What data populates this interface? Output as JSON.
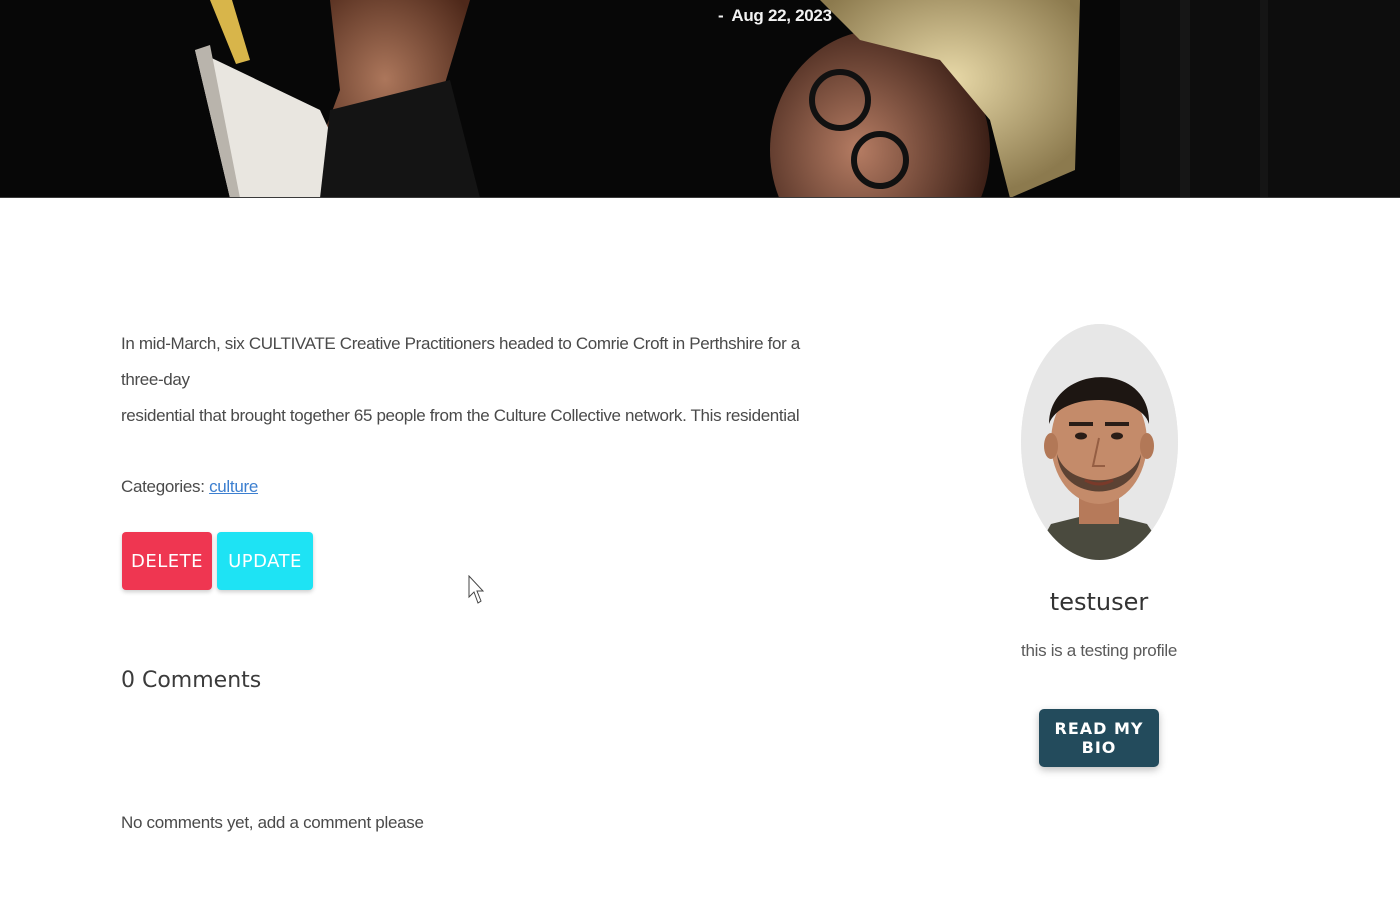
{
  "hero": {
    "date": "Aug 22, 2023",
    "separator": "-"
  },
  "post": {
    "excerpt_line1": "In mid-March, six CULTIVATE Creative Practitioners headed to Comrie Croft in Perthshire for a three-day",
    "excerpt_line2": "residential that brought together 65 people from the Culture Collective network. This residential",
    "categories_label": "Categories:",
    "category": "culture",
    "delete_label": "DELETE",
    "update_label": "UPDATE"
  },
  "comments": {
    "title": "0 Comments",
    "empty_message": "No comments yet, add a comment please"
  },
  "author": {
    "name": "testuser",
    "tagline": "this is a testing profile",
    "bio_button_label": "READ MY BIO"
  },
  "colors": {
    "delete": "#ef3651",
    "update": "#1ee3f4",
    "bio_button": "#234b5c",
    "link": "#3c7fd0"
  }
}
